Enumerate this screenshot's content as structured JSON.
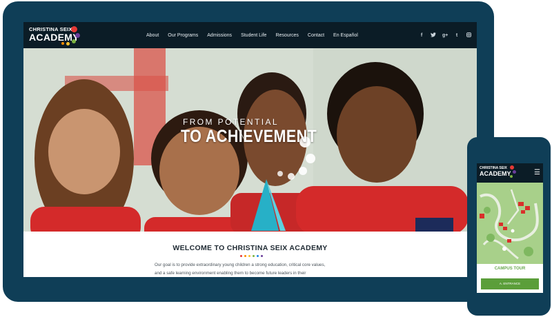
{
  "brand": {
    "line1": "CHRISTINA SEIX",
    "line2": "ACADEMY",
    "dot_colors": [
      "#e53935",
      "#6a3d9a",
      "#7cb342",
      "#fbc02d",
      "#fb8c00"
    ]
  },
  "nav": {
    "items": [
      "About",
      "Our Programs",
      "Admissions",
      "Student Life",
      "Resources",
      "Contact",
      "En Español"
    ]
  },
  "social_icons": [
    {
      "name": "facebook-icon",
      "glyph": "f"
    },
    {
      "name": "twitter-icon",
      "glyph": "🐦"
    },
    {
      "name": "google-plus-icon",
      "glyph": "g+"
    },
    {
      "name": "tumblr-icon",
      "glyph": "t"
    },
    {
      "name": "instagram-icon",
      "glyph": "◙"
    }
  ],
  "hero": {
    "tagline_small": "FROM POTENTIAL",
    "tagline_big": "TO ACHIEVEMENT"
  },
  "welcome": {
    "title": "WELCOME TO CHRISTINA SEIX ACADEMY",
    "body_line1": "Our goal is to provide extraordinary young children a strong education, critical core values,",
    "body_line2": "and a safe learning environment enabling them to become future leaders in their",
    "dot_colors": [
      "#e53935",
      "#fb8c00",
      "#fbc02d",
      "#7cb342",
      "#1e88e5",
      "#6a3d9a"
    ]
  },
  "mobile": {
    "campus_tour": "CAMPUS TOUR",
    "entrance_label": "A. ENTRANCE"
  },
  "colors": {
    "device_frame": "#0f3e57",
    "nav_bg": "#0b1c26",
    "accent_green": "#5b9e3a"
  }
}
